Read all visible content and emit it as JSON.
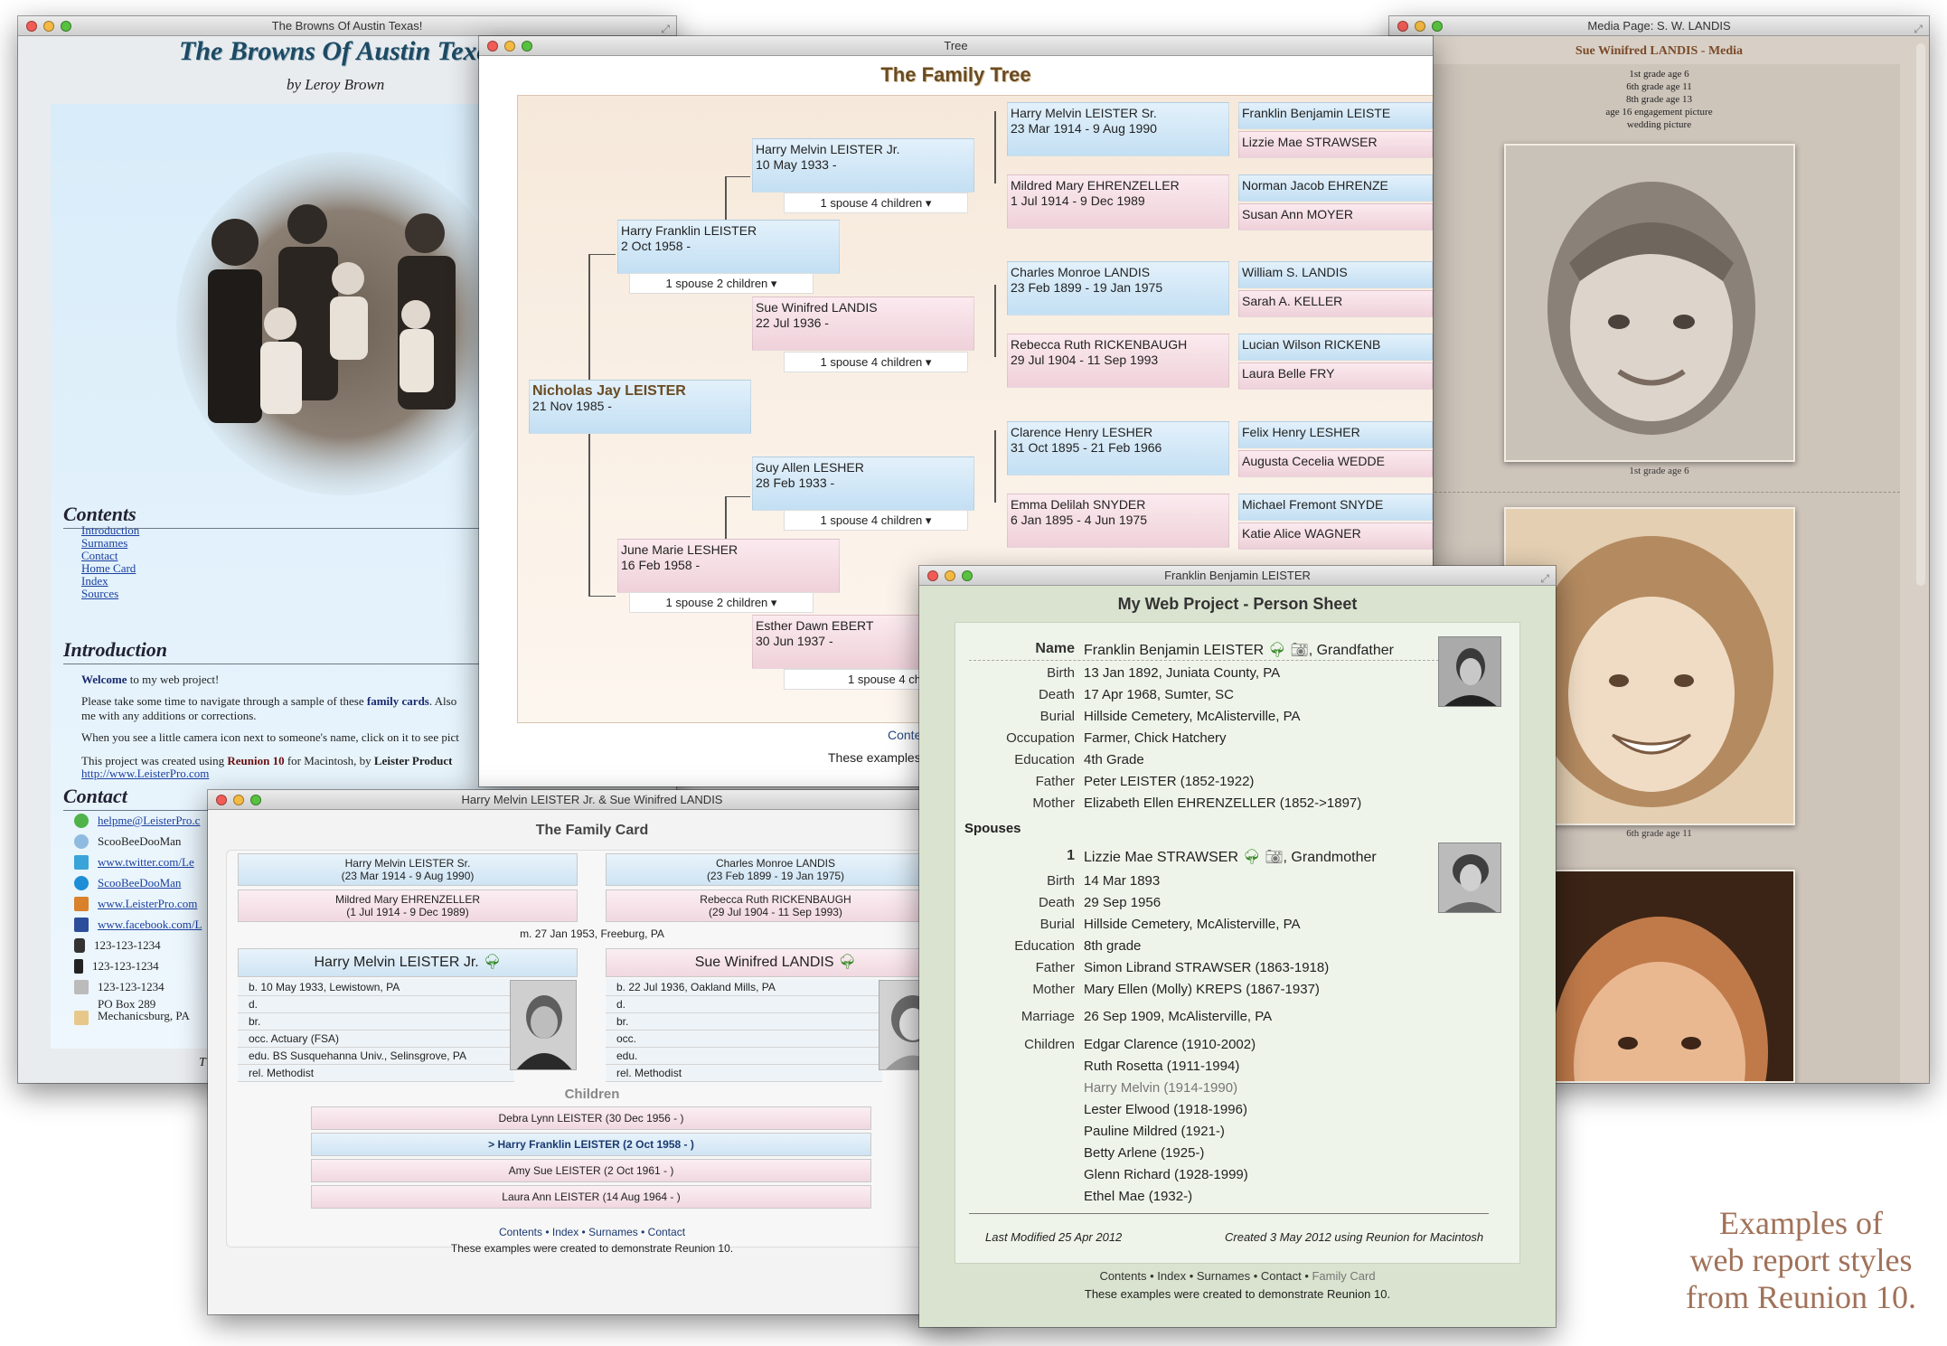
{
  "browns": {
    "window_title": "The Browns Of Austin Texas!",
    "heading": "The Browns Of Austin Texas",
    "byline": "by Leroy Brown",
    "contents_heading": "Contents",
    "toc": [
      "Introduction",
      "Surnames",
      "Contact",
      "Home Card",
      "Index",
      "Sources"
    ],
    "intro_heading": "Introduction",
    "intro_welcome": "Welcome",
    "intro_p1": " to my web project!",
    "intro_p2a": "Please take some time to navigate through a sample of these ",
    "intro_p2b": "family cards",
    "intro_p2c": ". Also",
    "intro_p2d": "me with any additions or corrections.",
    "intro_p3": "When you see a little camera icon next to someone's name, click on it to see pict",
    "intro_p4a": "This project was created using ",
    "intro_p4b": "Reunion 10",
    "intro_p4c": " for Macintosh, by ",
    "intro_p4d": "Leister Product",
    "intro_p4e": "http://www.LeisterPro.com",
    "contact_heading": "Contact",
    "contacts": [
      "helpme@LeisterPro.c",
      "ScooBeeDooMan",
      "www.twitter.com/Le",
      "ScooBeeDooMan",
      "www.LeisterPro.com",
      "www.facebook.com/L",
      "123-123-1234",
      "123-123-1234",
      "123-123-1234"
    ],
    "address": [
      "PO Box 289",
      "Mechanicsburg, PA"
    ],
    "footer_fragment": "T"
  },
  "tree": {
    "window_title": "Tree",
    "heading": "The Family Tree",
    "people": [
      {
        "name": "Nicholas Jay LEISTER",
        "dates": "21 Nov 1985 -"
      },
      {
        "name": "Harry Franklin LEISTER",
        "dates": "2 Oct 1958 -"
      },
      {
        "name": "June Marie LESHER",
        "dates": "16 Feb 1958 -"
      },
      {
        "name": "Harry Melvin LEISTER Jr.",
        "dates": "10 May 1933 -"
      },
      {
        "name": "Sue Winifred LANDIS",
        "dates": "22 Jul 1936 -"
      },
      {
        "name": "Guy Allen LESHER",
        "dates": "28 Feb 1933 -"
      },
      {
        "name": "Esther Dawn EBERT",
        "dates": "30 Jun 1937 -"
      },
      {
        "name": "Harry Melvin LEISTER Sr.",
        "dates": "23 Mar 1914 - 9 Aug 1990"
      },
      {
        "name": "Mildred Mary EHRENZELLER",
        "dates": "1 Jul 1914 - 9 Dec 1989"
      },
      {
        "name": "Charles Monroe LANDIS",
        "dates": "23 Feb 1899 - 19 Jan 1975"
      },
      {
        "name": "Rebecca Ruth RICKENBAUGH",
        "dates": "29 Jul 1904 - 11 Sep 1993"
      },
      {
        "name": "Clarence Henry LESHER",
        "dates": "31 Oct 1895 - 21 Feb 1966"
      },
      {
        "name": "Emma Delilah SNYDER",
        "dates": "6 Jan 1895 - 4 Jun 1975"
      }
    ],
    "greats": [
      "Franklin Benjamin LEISTE",
      "Lizzie Mae STRAWSER",
      "Norman Jacob EHRENZE",
      "Susan Ann MOYER",
      "William S. LANDIS",
      "Sarah A. KELLER",
      "Lucian Wilson RICKENB",
      "Laura Belle FRY",
      "Felix Henry LESHER",
      "Augusta Cecelia WEDDE",
      "Michael Fremont SNYDE",
      "Katie Alice WAGNER"
    ],
    "spouse_2": "1 spouse 2 children ▾",
    "spouse_4": "1 spouse 4 children ▾",
    "spouse_4_cut": "1 spouse 4 chi",
    "footer_contents": "Conte",
    "footer_note": "These examples"
  },
  "media": {
    "window_title": "Media Page: S. W. LANDIS",
    "heading": "Sue Winifred LANDIS - Media",
    "list": [
      "1st grade age 6",
      "6th grade age 11",
      "8th grade age 13",
      "age 16 engagement picture",
      "wedding picture"
    ],
    "cap1": "1st grade age 6",
    "cap2": "6th grade age 11"
  },
  "card": {
    "window_title": "Harry Melvin LEISTER Jr. & Sue Winifred LANDIS",
    "heading": "The Family Card",
    "gp_m1": "Harry Melvin LEISTER Sr.",
    "gp_m1d": "(23 Mar 1914 - 9 Aug 1990)",
    "gp_f1": "Mildred Mary EHRENZELLER",
    "gp_f1d": "(1 Jul 1914 - 9 Dec 1989)",
    "gp_m2": "Charles Monroe LANDIS",
    "gp_m2d": "(23 Feb 1899 - 19 Jan 1975)",
    "gp_f2": "Rebecca Ruth RICKENBAUGH",
    "gp_f2d": "(29 Jul 1904 - 11 Sep 1993)",
    "marriage": "m. 27 Jan 1953, Freeburg, PA",
    "husband": "Harry Melvin LEISTER Jr.",
    "wife": "Sue Winifred LANDIS",
    "h_rows": [
      "b. 10 May 1933, Lewistown, PA",
      "d.",
      "br.",
      "occ. Actuary (FSA)",
      "edu. BS Susquehanna Univ., Selinsgrove, PA",
      "rel. Methodist"
    ],
    "w_rows": [
      "b. 22 Jul 1936, Oakland Mills, PA",
      "d.",
      "br.",
      "occ.",
      "edu.",
      "rel. Methodist"
    ],
    "children_heading": "Children",
    "children": [
      "Debra Lynn LEISTER (30 Dec 1956 - )",
      "> Harry Franklin LEISTER (2 Oct 1958 - )",
      "Amy Sue LEISTER (2 Oct 1961 - )",
      "Laura Ann LEISTER (14 Aug 1964 - )"
    ],
    "nav": [
      "Contents",
      "Index",
      "Surnames",
      "Contact"
    ],
    "note": "These examples were created to demonstrate Reunion 10."
  },
  "sheet": {
    "window_title": "Franklin Benjamin LEISTER",
    "heading": "My Web Project - Person Sheet",
    "name_label": "Name",
    "name": "Franklin Benjamin LEISTER",
    "relation": ", Grandfather",
    "facts": [
      [
        "Birth",
        "13 Jan 1892, Juniata County, PA"
      ],
      [
        "Death",
        "17 Apr 1968, Sumter, SC"
      ],
      [
        "Burial",
        "Hillside Cemetery, McAlisterville, PA"
      ],
      [
        "Occupation",
        "Farmer, Chick Hatchery"
      ],
      [
        "Education",
        "4th Grade"
      ],
      [
        "Father",
        "Peter LEISTER (1852-1922)"
      ],
      [
        "Mother",
        "Elizabeth Ellen EHRENZELLER (1852->1897)"
      ]
    ],
    "spouses_label": "Spouses",
    "sp_num": "1",
    "sp_name": "Lizzie Mae STRAWSER",
    "sp_rel": ", Grandmother",
    "sp_facts": [
      [
        "Birth",
        "14 Mar 1893"
      ],
      [
        "Death",
        "29 Sep 1956"
      ],
      [
        "Burial",
        "Hillside Cemetery, McAlisterville, PA"
      ],
      [
        "Education",
        "8th grade"
      ],
      [
        "Father",
        "Simon Librand STRAWSER (1863-1918)"
      ],
      [
        "Mother",
        "Mary Ellen (Molly) KREPS (1867-1937)"
      ]
    ],
    "marriage_label": "Marriage",
    "marriage": "26 Sep 1909, McAlisterville, PA",
    "children_label": "Children",
    "children": [
      "Edgar Clarence (1910-2002)",
      "Ruth Rosetta (1911-1994)",
      "Harry Melvin (1914-1990)",
      "Lester Elwood (1918-1996)",
      "Pauline Mildred (1921-)",
      "Betty Arlene (1925-)",
      "Glenn Richard (1928-1999)",
      "Ethel Mae (1932-)"
    ],
    "modified": "Last Modified 25 Apr 2012",
    "created": "Created 3 May 2012 using Reunion for Macintosh",
    "nav": [
      "Contents",
      "Index",
      "Surnames",
      "Contact",
      "Family Card"
    ],
    "note": "These examples were created to demonstrate Reunion 10."
  },
  "caption": [
    "Examples of",
    "web report styles",
    "from Reunion 10."
  ],
  "colors": {
    "male": "#c8e2f5",
    "female": "#f1d7df",
    "tree_title": "#6a4b22",
    "caption": "#a0725a"
  }
}
